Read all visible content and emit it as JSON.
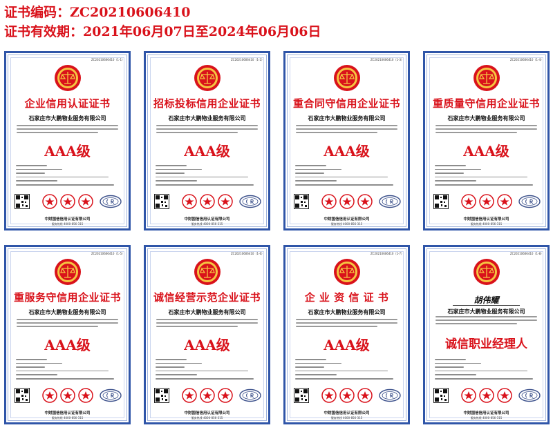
{
  "header": {
    "cert_number_line": "证书编码：ZC20210606410",
    "validity_line": "证书有效期：2021年06月07日至2024年06月06日"
  },
  "colors": {
    "accent_red": "#d9121b",
    "frame_blue": "#2f55a8"
  },
  "certificates": [
    {
      "no": "ZC20210606410（1-1）",
      "title": "企业信用认证证书",
      "company": "石家庄市大鹏物业服务有限公司",
      "grade": "AAA级",
      "issuer": "中财国信信用认证有限公司",
      "hotline": "服务热线 4000-856-315"
    },
    {
      "no": "ZC20210606410（1-2）",
      "title": "招标投标信用企业证书",
      "company": "石家庄市大鹏物业服务有限公司",
      "grade": "AAA级",
      "issuer": "中财国信信用认证有限公司",
      "hotline": "服务热线 4000-856-315"
    },
    {
      "no": "ZC20210606410（1-3）",
      "title": "重合同守信用企业证书",
      "company": "石家庄市大鹏物业服务有限公司",
      "grade": "AAA级",
      "issuer": "中财国信信用认证有限公司",
      "hotline": "服务热线 4000-856-315"
    },
    {
      "no": "ZC20210606410（1-4）",
      "title": "重质量守信用企业证书",
      "company": "石家庄市大鹏物业服务有限公司",
      "grade": "AAA级",
      "issuer": "中财国信信用认证有限公司",
      "hotline": "服务热线 4000-856-315"
    },
    {
      "no": "ZC20210606410（1-5）",
      "title": "重服务守信用企业证书",
      "company": "石家庄市大鹏物业服务有限公司",
      "grade": "AAA级",
      "issuer": "中财国信信用认证有限公司",
      "hotline": "服务热线 4000-856-315"
    },
    {
      "no": "ZC20210606410（1-6）",
      "title": "诚信经营示范企业证书",
      "company": "石家庄市大鹏物业服务有限公司",
      "grade": "AAA级",
      "issuer": "中财国信信用认证有限公司",
      "hotline": "服务热线 4000-856-315"
    },
    {
      "no": "ZC20210606410（1-7）",
      "title": "企 业 资 信 证 书",
      "company": "石家庄市大鹏物业服务有限公司",
      "grade": "AAA级",
      "issuer": "中财国信信用认证有限公司",
      "hotline": "服务热线 4000-856-315"
    }
  ],
  "manager_certificate": {
    "no": "ZC20210606410（1-8）",
    "person": "胡伟耀",
    "company": "石家庄市大鹏物业服务有限公司",
    "title": "诚信职业经理人",
    "issuer": "中财国信信用认证有限公司",
    "hotline": "服务热线 4000-856-315"
  }
}
